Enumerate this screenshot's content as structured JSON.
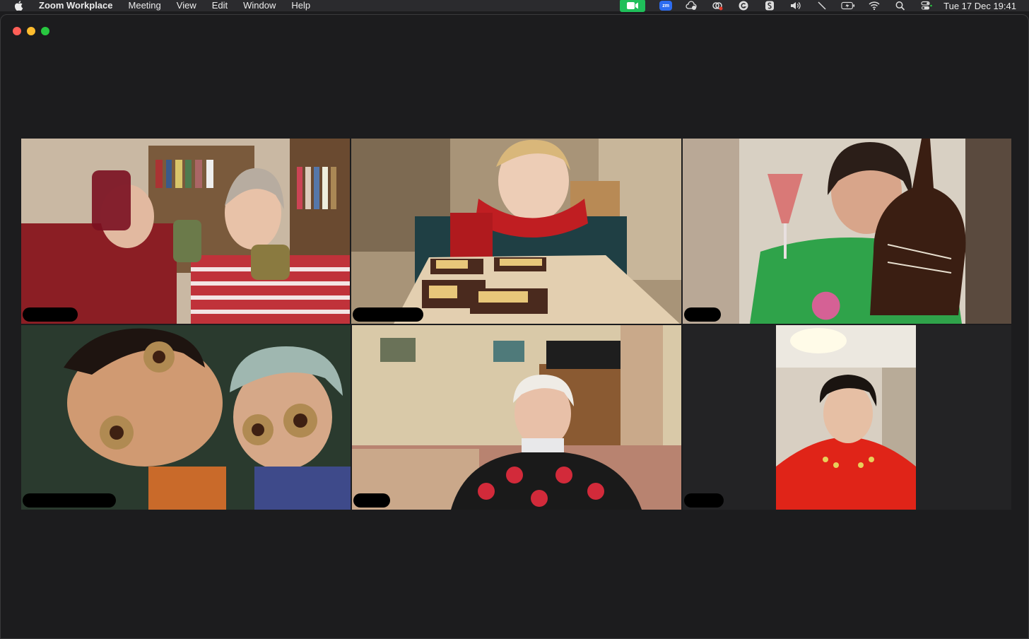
{
  "menubar": {
    "app_name": "Zoom Workplace",
    "items": [
      "Meeting",
      "View",
      "Edit",
      "Window",
      "Help"
    ],
    "clock": "Tue 17 Dec  19:41",
    "zm_badge": "zm"
  },
  "colors": {
    "active_speaker_border": "#3dd45c",
    "zoom_status_green": "#1fbf5a",
    "window_bg": "#1c1c1e"
  },
  "tiles": [
    {
      "participant_name": ""
    },
    {
      "participant_name": "",
      "active_speaker": true
    },
    {
      "participant_name": ""
    },
    {
      "participant_name": ""
    },
    {
      "participant_name": ""
    },
    {
      "participant_name": ""
    }
  ]
}
